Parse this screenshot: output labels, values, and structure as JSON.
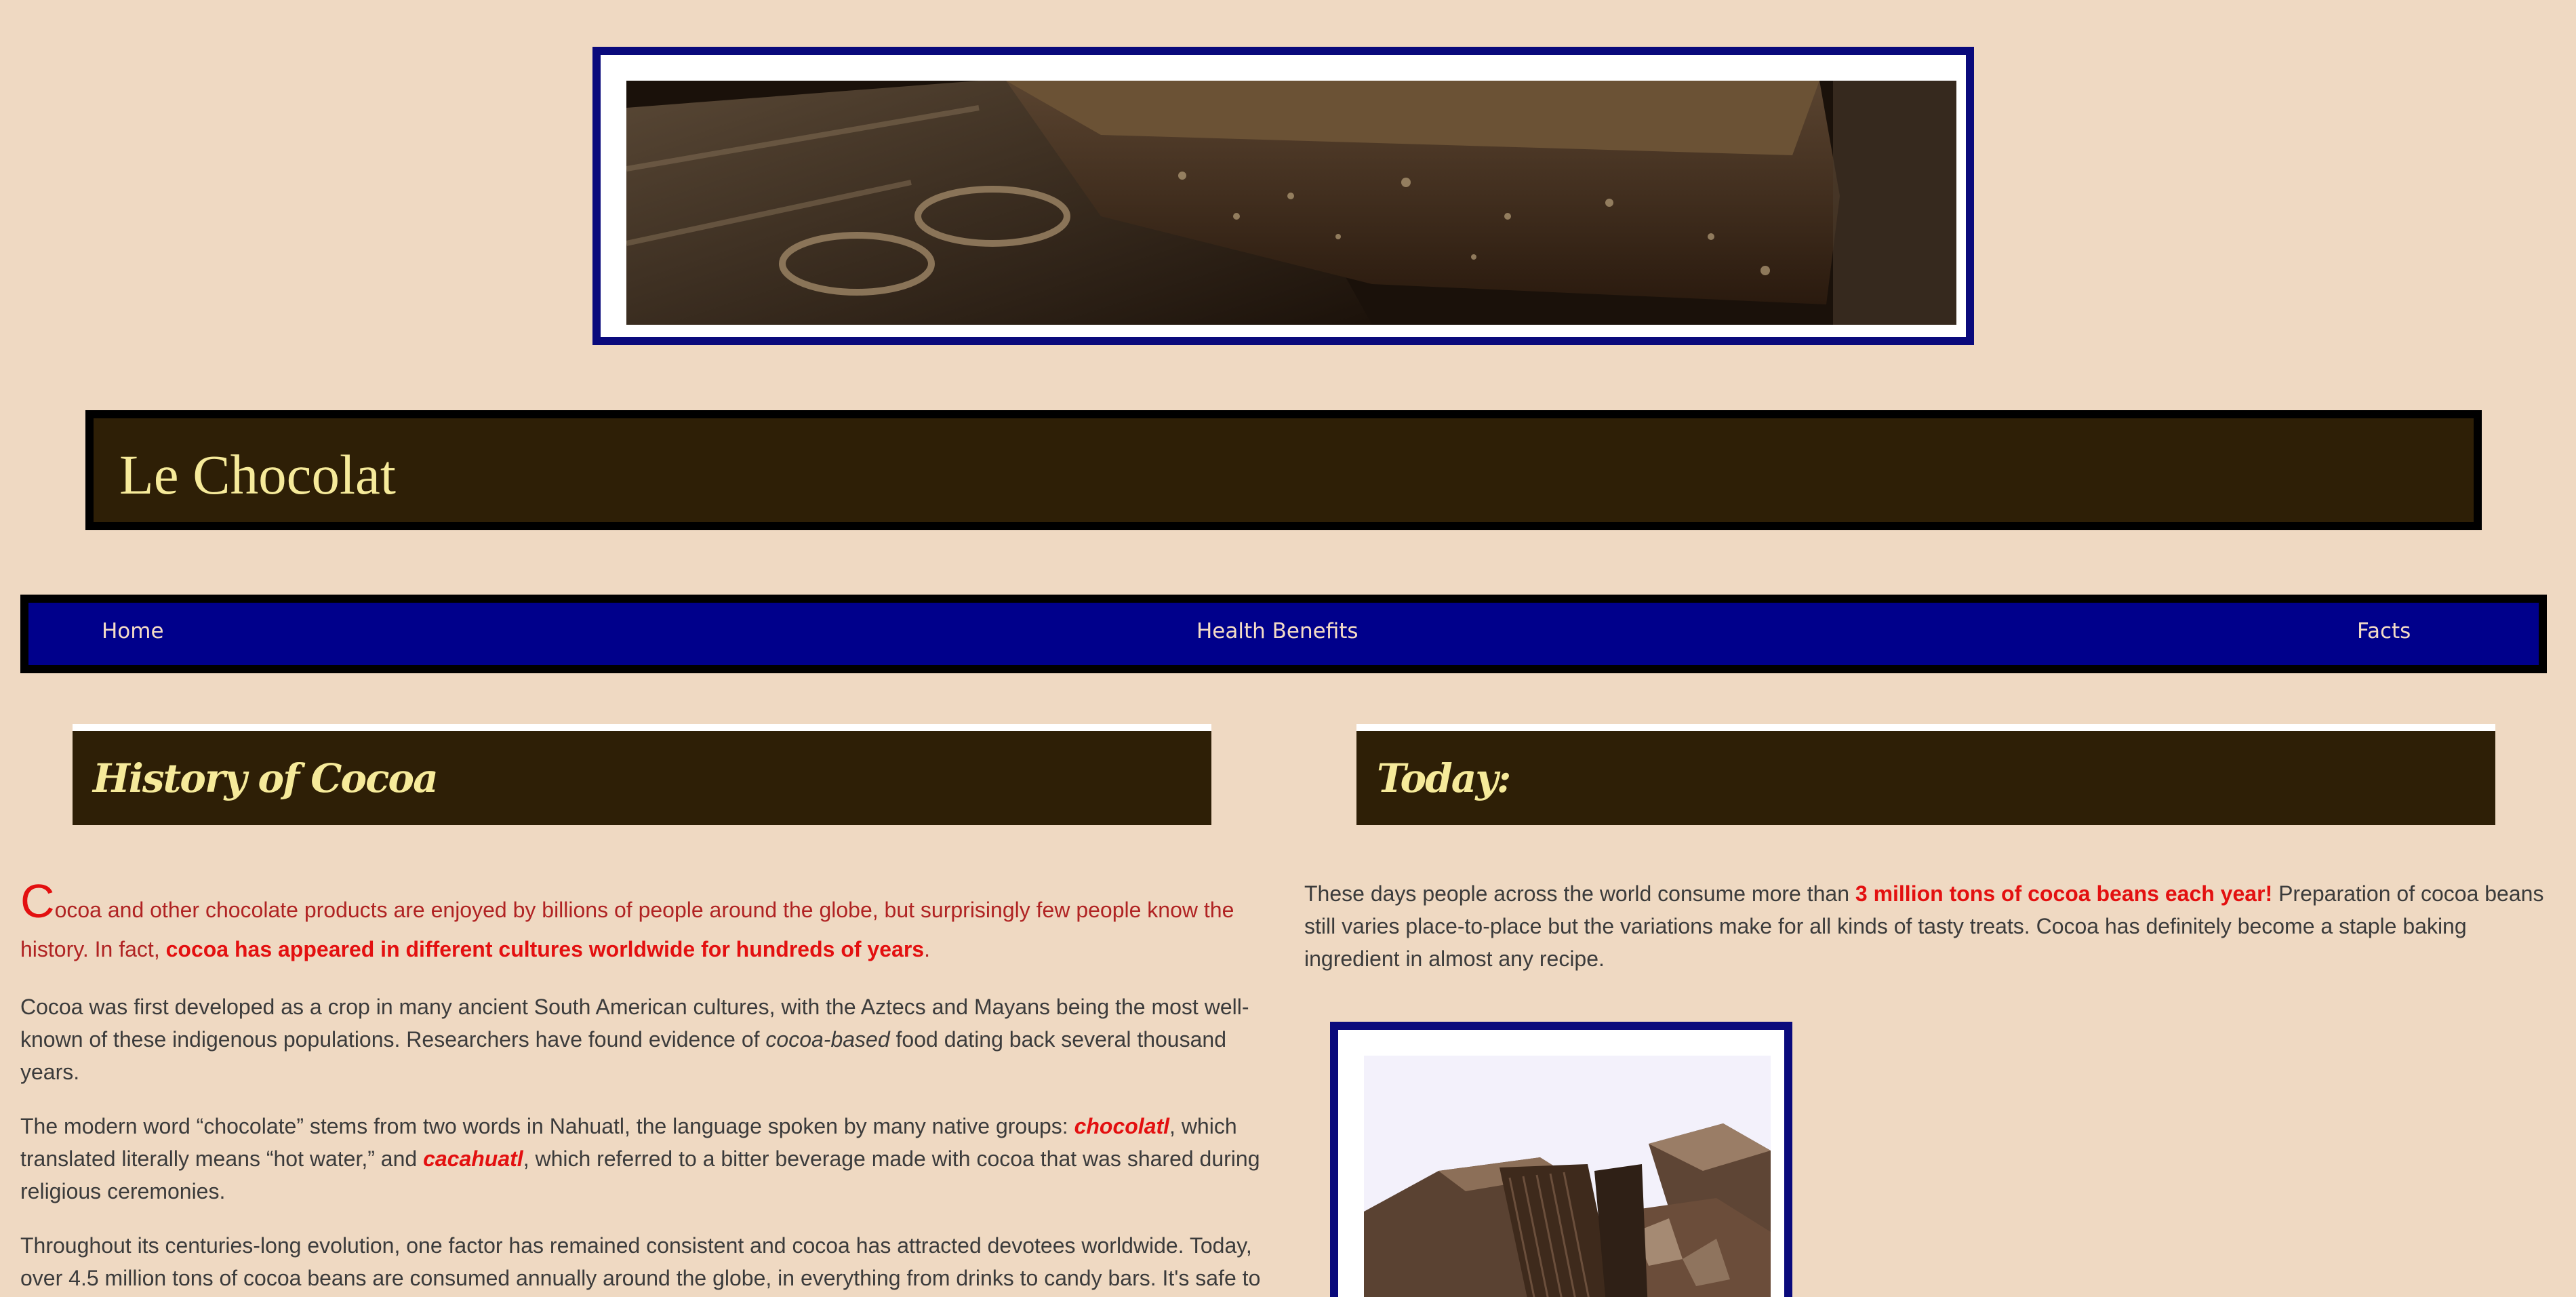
{
  "site": {
    "title": "Le Chocolat"
  },
  "hero": {
    "alt": "Close-up of chocolate bars"
  },
  "nav": {
    "home": "Home",
    "health": "Health Benefits",
    "facts": "Facts"
  },
  "history": {
    "heading": "History of Cocoa",
    "intro_dropcap": "C",
    "intro_text": "ocoa and other chocolate products are enjoyed by billions of people around the globe, but surprisingly few people know the history. In fact, ",
    "intro_bold": "cocoa has appeared in different cultures worldwide for hundreds of years",
    "intro_end": ".",
    "p2_a": "Cocoa was first developed as a crop in many ancient South American cultures, with the Aztecs and Mayans being the most well-known of these indigenous populations. Researchers have found evidence of ",
    "p2_italic": "cocoa-based",
    "p2_b": " food dating back several thousand years.",
    "p3_a": "The modern word “chocolate” stems from two words in Nahuatl, the language spoken by many native groups: ",
    "p3_word1": "chocolatl",
    "p3_b": ", which translated literally means “hot water,” and ",
    "p3_word2": "cacahuatl",
    "p3_c": ", which referred to a bitter beverage made with cocoa that was shared during religious ceremonies.",
    "p4": "Throughout its centuries-long evolution, one factor has remained consistent and cocoa has attracted devotees worldwide. Today, over 4.5 million tons of cocoa beans are consumed annually around the globe, in everything from drinks to candy bars. It's safe to"
  },
  "today": {
    "heading": "Today:",
    "p1_a": "These days people across the world consume more than ",
    "p1_bold": "3 million tons of cocoa beans each year!",
    "p1_b": " Preparation of cocoa beans still varies place-to-place but the variations make for all kinds of tasty treats. Cocoa has definitely become a staple baking ingredient in almost any recipe."
  },
  "colors": {
    "background": "#efd9c2",
    "banner": "#2e1f06",
    "banner_text": "#f6ea9a",
    "nav": "#00008b",
    "frame": "#0a0a7c",
    "accent_red": "#e31010"
  },
  "icons": {
    "hero": "chocolate-bars-photo",
    "side": "chocolate-pieces-photo"
  }
}
